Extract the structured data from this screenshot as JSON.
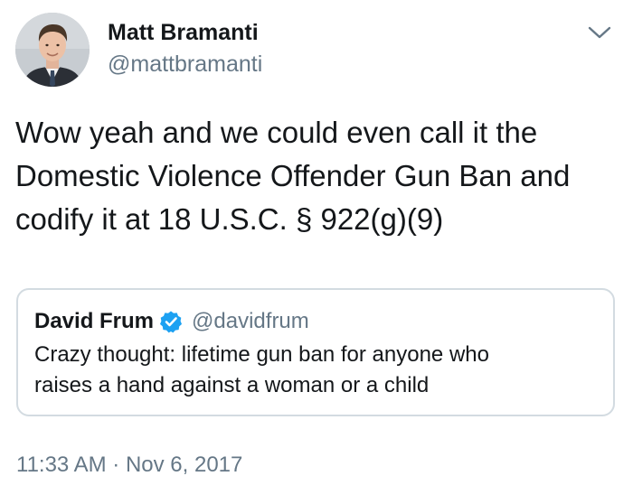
{
  "tweet": {
    "author": {
      "name": "Matt Bramanti",
      "handle": "@mattbramanti"
    },
    "text_lines": [
      "Wow yeah and we could even call it the",
      "Domestic Violence Offender Gun Ban and",
      "codify it at 18 U.S.C. § 922(g)(9)"
    ],
    "timestamp": "11:33 AM · Nov 6, 2017"
  },
  "quoted_tweet": {
    "author": {
      "name": "David Frum",
      "handle": "@davidfrum",
      "verified": true
    },
    "text_lines": [
      "Crazy thought: lifetime gun ban for anyone who",
      "raises a hand against a woman or a child"
    ]
  },
  "icons": {
    "menu": "chevron-down-icon",
    "verified": "verified-badge-icon"
  },
  "colors": {
    "text": "#14171a",
    "secondary_text": "#657786",
    "verified_blue": "#1da1f2",
    "quote_border": "#d3dbe1"
  }
}
